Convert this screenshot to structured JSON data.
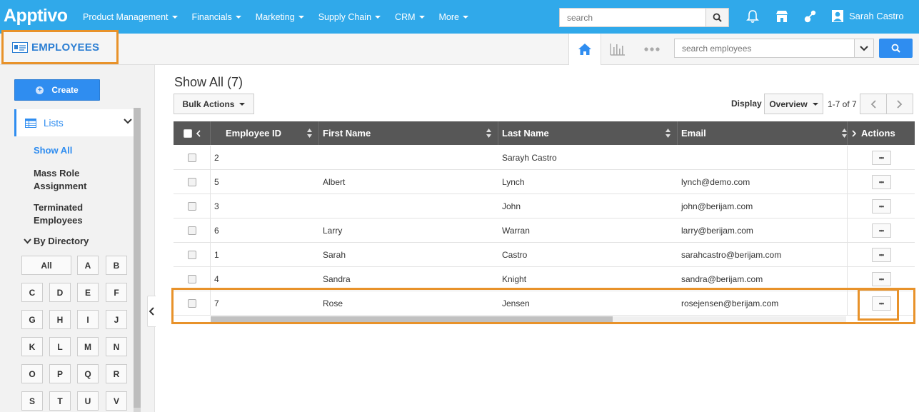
{
  "app": {
    "logo": "Apptivo",
    "module_title": "EMPLOYEES"
  },
  "topnav": {
    "menu": [
      {
        "label": "Product Management"
      },
      {
        "label": "Financials"
      },
      {
        "label": "Marketing"
      },
      {
        "label": "Supply Chain"
      },
      {
        "label": "CRM"
      },
      {
        "label": "More"
      }
    ],
    "search_placeholder": "search",
    "user_name": "Sarah Castro"
  },
  "subheader": {
    "search_placeholder": "search employees",
    "views": [
      "home-icon",
      "chart-icon",
      "more-dots-icon"
    ]
  },
  "sidebar": {
    "create_label": "Create",
    "lists_label": "Lists",
    "links": [
      {
        "label": "Show All",
        "active": true
      },
      {
        "label": "Mass Role Assignment",
        "active": false
      },
      {
        "label": "Terminated Employees",
        "active": false
      }
    ],
    "directory_label": "By Directory",
    "letters": [
      "All",
      "A",
      "B",
      "C",
      "D",
      "E",
      "F",
      "G",
      "H",
      "I",
      "J",
      "K",
      "L",
      "M",
      "N",
      "O",
      "P",
      "Q",
      "R",
      "S",
      "T",
      "U",
      "V"
    ]
  },
  "main": {
    "heading": "Show All (7)",
    "bulk_actions_label": "Bulk Actions",
    "display_label": "Display",
    "display_value": "Overview",
    "page_info": "1-7 of 7",
    "columns": [
      "Employee ID",
      "First Name",
      "Last Name",
      "Email",
      "Actions"
    ],
    "rows": [
      {
        "id": "2",
        "first": "",
        "last": "Sarayh Castro",
        "email": ""
      },
      {
        "id": "5",
        "first": "Albert",
        "last": "Lynch",
        "email": "lynch@demo.com"
      },
      {
        "id": "3",
        "first": "",
        "last": "John",
        "email": "john@berijam.com"
      },
      {
        "id": "6",
        "first": "Larry",
        "last": "Warran",
        "email": "larry@berijam.com"
      },
      {
        "id": "1",
        "first": "Sarah",
        "last": "Castro",
        "email": "sarahcastro@berijam.com"
      },
      {
        "id": "4",
        "first": "Sandra",
        "last": "Knight",
        "email": "sandra@berijam.com"
      },
      {
        "id": "7",
        "first": "Rose",
        "last": "Jensen",
        "email": "rosejensen@berijam.com"
      }
    ],
    "action_button_label": "•••"
  },
  "colors": {
    "nav_bg": "#30a9ea",
    "accent": "#2f8df0",
    "header_bg": "#575757",
    "highlight": "#e8922a"
  }
}
